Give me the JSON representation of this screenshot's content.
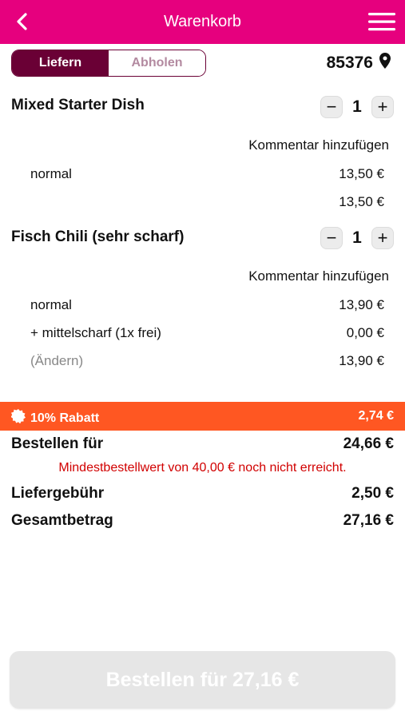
{
  "header": {
    "title": "Warenkorb"
  },
  "delivery": {
    "options": [
      "Liefern",
      "Abholen"
    ],
    "selected": "Liefern",
    "zip": "85376"
  },
  "items": [
    {
      "name": "Mixed Starter Dish",
      "qty": "1",
      "comment_label": "Kommentar hinzufügen",
      "lines": [
        {
          "label": "normal",
          "price": "13,50 €"
        }
      ],
      "subtotal": "13,50 €"
    },
    {
      "name": "Fisch Chili (sehr scharf)",
      "qty": "1",
      "comment_label": "Kommentar hinzufügen",
      "lines": [
        {
          "label": "normal",
          "price": "13,90 €"
        },
        {
          "label": "+ mittelscharf (1x frei)",
          "price": "0,00 €"
        }
      ],
      "change_label": "(Ändern)",
      "subtotal": "13,90 €"
    }
  ],
  "discount": {
    "label": "10% Rabatt",
    "value": "2,74 €"
  },
  "summary": {
    "order_for_label": "Bestellen für",
    "order_for_value": "24,66 €",
    "min_order_warning": "Mindestbestellwert von 40,00 € noch nicht erreicht.",
    "delivery_fee_label": "Liefergebühr",
    "delivery_fee_value": "2,50 €",
    "total_label": "Gesamtbetrag",
    "total_value": "27,16 €"
  },
  "order_button": {
    "label": "Bestellen für 27,16 €"
  },
  "colors": {
    "brand": "#e6007e",
    "segment": "#6a0035",
    "discount": "#ff5722",
    "warning": "#d10000"
  }
}
